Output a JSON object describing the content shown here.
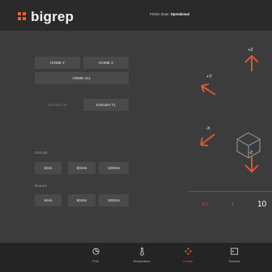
{
  "app": {
    "logo_text": "bigrep"
  },
  "status": {
    "label": "Printer State:",
    "value": "Operational"
  },
  "homing": {
    "home_y": "HOME Y",
    "home_x": "HOME X",
    "home_all": "HOME ALL"
  },
  "extruder_select": {
    "t0": "Extruder T0",
    "t1": "Extruder T1"
  },
  "extrude": {
    "label": "Extrude",
    "options": [
      "5mm",
      "50mm",
      "100mm"
    ]
  },
  "retract": {
    "label": "Retract",
    "options": [
      "5mm",
      "50mm",
      "100mm"
    ]
  },
  "jog": {
    "plus_z": "+Z",
    "plus_y": "+Y",
    "minus_x": "-X",
    "minus_z": "-Z"
  },
  "step_sizes": {
    "s01": "0.1",
    "s1": "1",
    "s10": "10"
  },
  "nav": {
    "items": [
      {
        "label": "Print",
        "icon": "print-icon"
      },
      {
        "label": "Temperature",
        "icon": "thermometer-icon"
      },
      {
        "label": "Control",
        "icon": "move-icon"
      },
      {
        "label": "Terminal",
        "icon": "terminal-icon"
      }
    ]
  },
  "colors": {
    "accent": "#e65a32",
    "topbar": "#2a2a2a",
    "content": "#3c3c3c",
    "button": "#4a4a4a"
  }
}
